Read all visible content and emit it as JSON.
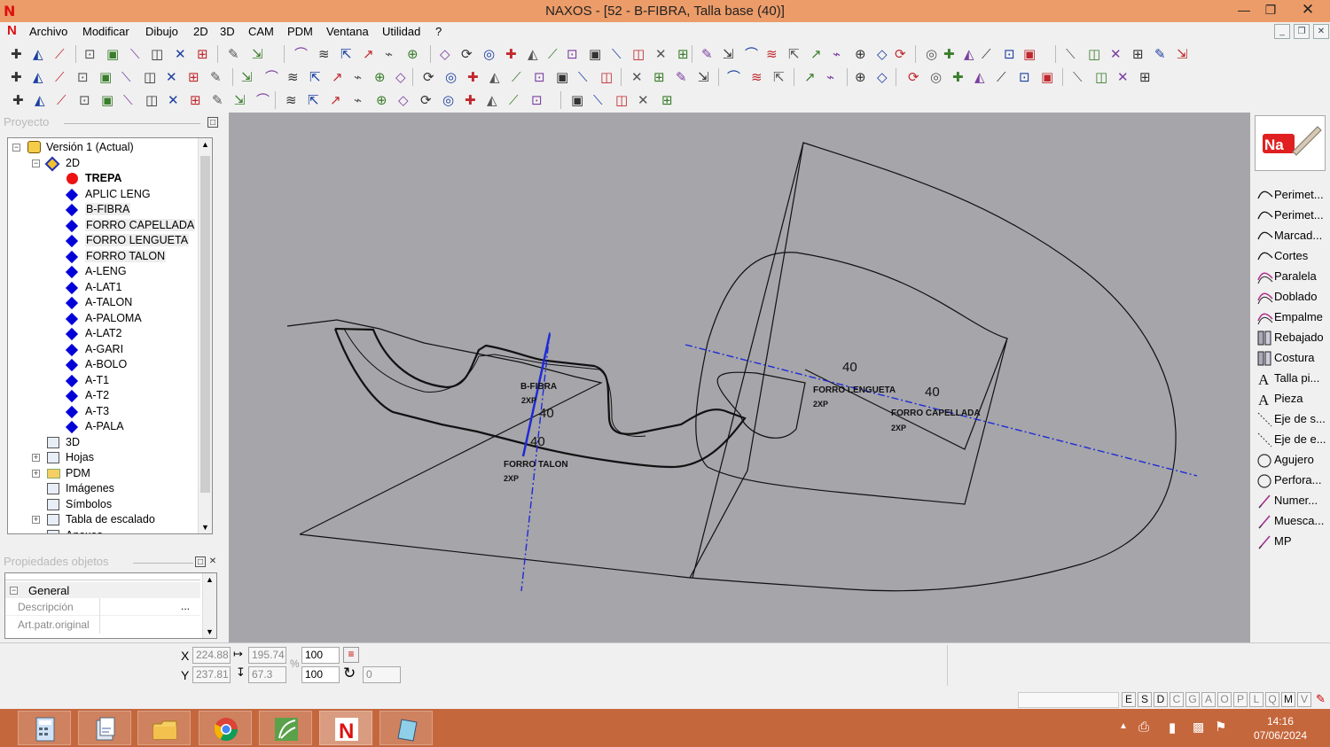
{
  "window": {
    "title": "NAXOS - [52 - B-FIBRA, Talla base (40)]",
    "logo": "N"
  },
  "menu": [
    "Archivo",
    "Modificar",
    "Dibujo",
    "2D",
    "3D",
    "CAM",
    "PDM",
    "Ventana",
    "Utilidad",
    "?"
  ],
  "left_panel": {
    "project_header": "Proyecto",
    "tree": [
      {
        "label": "Versión 1 (Actual)",
        "level": 0,
        "icon": "version-icon",
        "expander": "−"
      },
      {
        "label": "2D",
        "level": 1,
        "icon": "2d-icon",
        "expander": "−"
      },
      {
        "label": "TREPA",
        "level": 2,
        "icon": "red-dot-icon",
        "bold": true
      },
      {
        "label": "APLIC LENG",
        "level": 2,
        "icon": "piece-diamond-icon"
      },
      {
        "label": "B-FIBRA",
        "level": 2,
        "icon": "piece-diamond-icon",
        "highlight": true
      },
      {
        "label": "FORRO CAPELLADA",
        "level": 2,
        "icon": "piece-diamond-icon",
        "highlight": true
      },
      {
        "label": "FORRO LENGUETA",
        "level": 2,
        "icon": "piece-diamond-icon",
        "highlight": true
      },
      {
        "label": "FORRO TALON",
        "level": 2,
        "icon": "piece-diamond-icon",
        "highlight": true
      },
      {
        "label": "A-LENG",
        "level": 2,
        "icon": "piece-diamond-icon"
      },
      {
        "label": "A-LAT1",
        "level": 2,
        "icon": "piece-diamond-icon"
      },
      {
        "label": "A-TALON",
        "level": 2,
        "icon": "piece-diamond-icon"
      },
      {
        "label": "A-PALOMA",
        "level": 2,
        "icon": "piece-diamond-icon"
      },
      {
        "label": "A-LAT2",
        "level": 2,
        "icon": "piece-diamond-icon"
      },
      {
        "label": "A-GARI",
        "level": 2,
        "icon": "piece-diamond-icon"
      },
      {
        "label": "A-BOLO",
        "level": 2,
        "icon": "piece-diamond-icon"
      },
      {
        "label": "A-T1",
        "level": 2,
        "icon": "piece-diamond-icon"
      },
      {
        "label": "A-T2",
        "level": 2,
        "icon": "piece-diamond-icon"
      },
      {
        "label": "A-T3",
        "level": 2,
        "icon": "piece-diamond-icon"
      },
      {
        "label": "A-PALA",
        "level": 2,
        "icon": "piece-diamond-icon"
      },
      {
        "label": "3D",
        "level": 1,
        "icon": "3d-icon"
      },
      {
        "label": "Hojas",
        "level": 1,
        "icon": "sheets-icon",
        "expander": "+"
      },
      {
        "label": "PDM",
        "level": 1,
        "icon": "folder-icon",
        "expander": "+"
      },
      {
        "label": "Imágenes",
        "level": 1,
        "icon": "images-icon"
      },
      {
        "label": "Símbolos",
        "level": 1,
        "icon": "symbols-icon"
      },
      {
        "label": "Tabla de escalado",
        "level": 1,
        "icon": "table-icon",
        "expander": "+"
      },
      {
        "label": "Anexos",
        "level": 1,
        "icon": "attach-icon"
      }
    ],
    "props_header": "Propiedades objetos",
    "props": {
      "group": "General",
      "rows": [
        {
          "key": "Descripción",
          "value": "",
          "button": "..."
        },
        {
          "key": "Art.patr.original",
          "value": ""
        }
      ]
    }
  },
  "canvas": {
    "labels": [
      {
        "text": "B-FIBRA",
        "sub": "2XP"
      },
      {
        "text": "FORRO TALON",
        "sub": "2XP"
      },
      {
        "text": "FORRO LENGUETA",
        "sub": "2XP"
      },
      {
        "text": "FORRO CAPELLADA",
        "sub": "2XP"
      }
    ],
    "sizes": [
      "40",
      "40",
      "40",
      "40"
    ]
  },
  "right_tools": [
    {
      "label": "Perimet...",
      "icon": "curve-icon"
    },
    {
      "label": "Perimet...",
      "icon": "curve-icon"
    },
    {
      "label": "Marcad...",
      "icon": "curve-icon"
    },
    {
      "label": "Cortes",
      "icon": "curve-icon"
    },
    {
      "label": "Paralela",
      "icon": "parallel-icon"
    },
    {
      "label": "Doblado",
      "icon": "fold-icon"
    },
    {
      "label": "Empalme",
      "icon": "joint-icon"
    },
    {
      "label": "Rebajado",
      "icon": "skive-icon"
    },
    {
      "label": "Costura",
      "icon": "seam-icon"
    },
    {
      "label": "Talla pi...",
      "icon": "text-a-icon"
    },
    {
      "label": "Pieza",
      "icon": "text-a-icon"
    },
    {
      "label": "Eje de s...",
      "icon": "axis-icon"
    },
    {
      "label": "Eje de e...",
      "icon": "axis-icon"
    },
    {
      "label": "Agujero",
      "icon": "circle-icon"
    },
    {
      "label": "Perfora...",
      "icon": "circle-icon"
    },
    {
      "label": "Numer...",
      "icon": "pen-icon"
    },
    {
      "label": "Muesca...",
      "icon": "pen-icon"
    },
    {
      "label": "MP",
      "icon": "pen-icon"
    }
  ],
  "status": {
    "x": "224.88",
    "y": "237.81",
    "w": "195.74",
    "h": "67.3",
    "scale_x": "100",
    "scale_y": "100",
    "rotation": "0",
    "x_label": "X",
    "y_label": "Y",
    "percent": "%",
    "letters": [
      "E",
      "S",
      "D",
      "C",
      "G",
      "A",
      "O",
      "P",
      "L",
      "Q",
      "M",
      "V"
    ]
  },
  "taskbar": {
    "time": "14:16",
    "date": "07/06/2024"
  }
}
